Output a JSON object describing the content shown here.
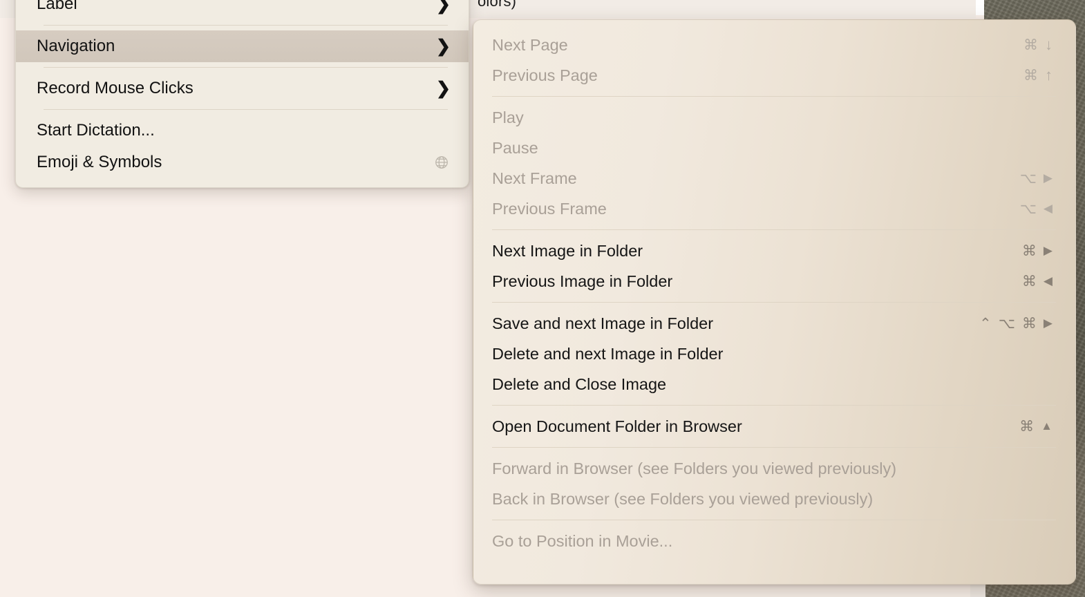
{
  "background": {
    "window_partial_text": "olors)",
    "page_bg_color": "#f8efe9",
    "photo_strip_color": "#625f52"
  },
  "parent_menu": {
    "name": "Edit menu",
    "items": [
      {
        "id": "label",
        "label": "Label",
        "chevron": "chevron-right-icon",
        "highlighted": false,
        "enabled": true
      },
      {
        "id": "navigation",
        "label": "Navigation",
        "chevron": "chevron-right-icon",
        "highlighted": true,
        "enabled": true
      },
      {
        "id": "record-mouse-clicks",
        "label": "Record Mouse Clicks",
        "chevron": "chevron-right-icon",
        "highlighted": false,
        "enabled": true
      },
      {
        "id": "start-dictation",
        "label": "Start Dictation...",
        "chevron": "",
        "highlighted": false,
        "enabled": true
      },
      {
        "id": "emoji-symbols",
        "label": "Emoji & Symbols",
        "chevron": "",
        "highlighted": false,
        "enabled": true,
        "trailing_icon": "globe-icon"
      }
    ],
    "chevron_glyph": "❯"
  },
  "submenu": {
    "name": "Navigation submenu",
    "groups": [
      {
        "id": "pages",
        "items": [
          {
            "id": "next-page",
            "label": "Next Page",
            "shortcut": [
              "command",
              "arrow-down"
            ],
            "enabled": false
          },
          {
            "id": "previous-page",
            "label": "Previous Page",
            "shortcut": [
              "command",
              "arrow-up"
            ],
            "enabled": false
          }
        ]
      },
      {
        "id": "playback",
        "items": [
          {
            "id": "play",
            "label": "Play",
            "shortcut": [],
            "enabled": false
          },
          {
            "id": "pause",
            "label": "Pause",
            "shortcut": [],
            "enabled": false
          },
          {
            "id": "next-frame",
            "label": "Next Frame",
            "shortcut": [
              "option",
              "triangle-right"
            ],
            "enabled": false
          },
          {
            "id": "previous-frame",
            "label": "Previous Frame",
            "shortcut": [
              "option",
              "triangle-left"
            ],
            "enabled": false
          }
        ]
      },
      {
        "id": "folder-images",
        "items": [
          {
            "id": "next-image-in-folder",
            "label": "Next Image in Folder",
            "shortcut": [
              "command",
              "triangle-right"
            ],
            "enabled": true
          },
          {
            "id": "previous-image-in-folder",
            "label": "Previous Image in Folder",
            "shortcut": [
              "command",
              "triangle-left"
            ],
            "enabled": true
          }
        ]
      },
      {
        "id": "save-delete",
        "items": [
          {
            "id": "save-and-next-image-in-folder",
            "label": "Save and next Image in Folder",
            "shortcut": [
              "control",
              "option",
              "command",
              "triangle-right"
            ],
            "enabled": true
          },
          {
            "id": "delete-and-next-image-in-folder",
            "label": "Delete and next Image in Folder",
            "shortcut": [],
            "enabled": true
          },
          {
            "id": "delete-and-close-image",
            "label": "Delete and Close Image",
            "shortcut": [],
            "enabled": true
          }
        ]
      },
      {
        "id": "browser-open",
        "items": [
          {
            "id": "open-document-folder-in-browser",
            "label": "Open Document Folder in Browser",
            "shortcut": [
              "command",
              "triangle-up"
            ],
            "enabled": true
          }
        ]
      },
      {
        "id": "browser-history",
        "items": [
          {
            "id": "forward-in-browser",
            "label": "Forward in Browser (see Folders you viewed previously)",
            "shortcut": [],
            "enabled": false
          },
          {
            "id": "back-in-browser",
            "label": "Back in Browser (see Folders you viewed previously)",
            "shortcut": [],
            "enabled": false
          }
        ]
      },
      {
        "id": "movie",
        "items": [
          {
            "id": "go-to-position-in-movie",
            "label": "Go to Position in Movie...",
            "shortcut": [],
            "enabled": false
          }
        ]
      }
    ],
    "glyphs": {
      "command": "⌘",
      "option": "⌥",
      "control": "⌃",
      "shift": "⇧",
      "arrow-down": "↓",
      "arrow-up": "↑",
      "triangle-right": "▶",
      "triangle-left": "◀",
      "triangle-up": "▲"
    }
  }
}
